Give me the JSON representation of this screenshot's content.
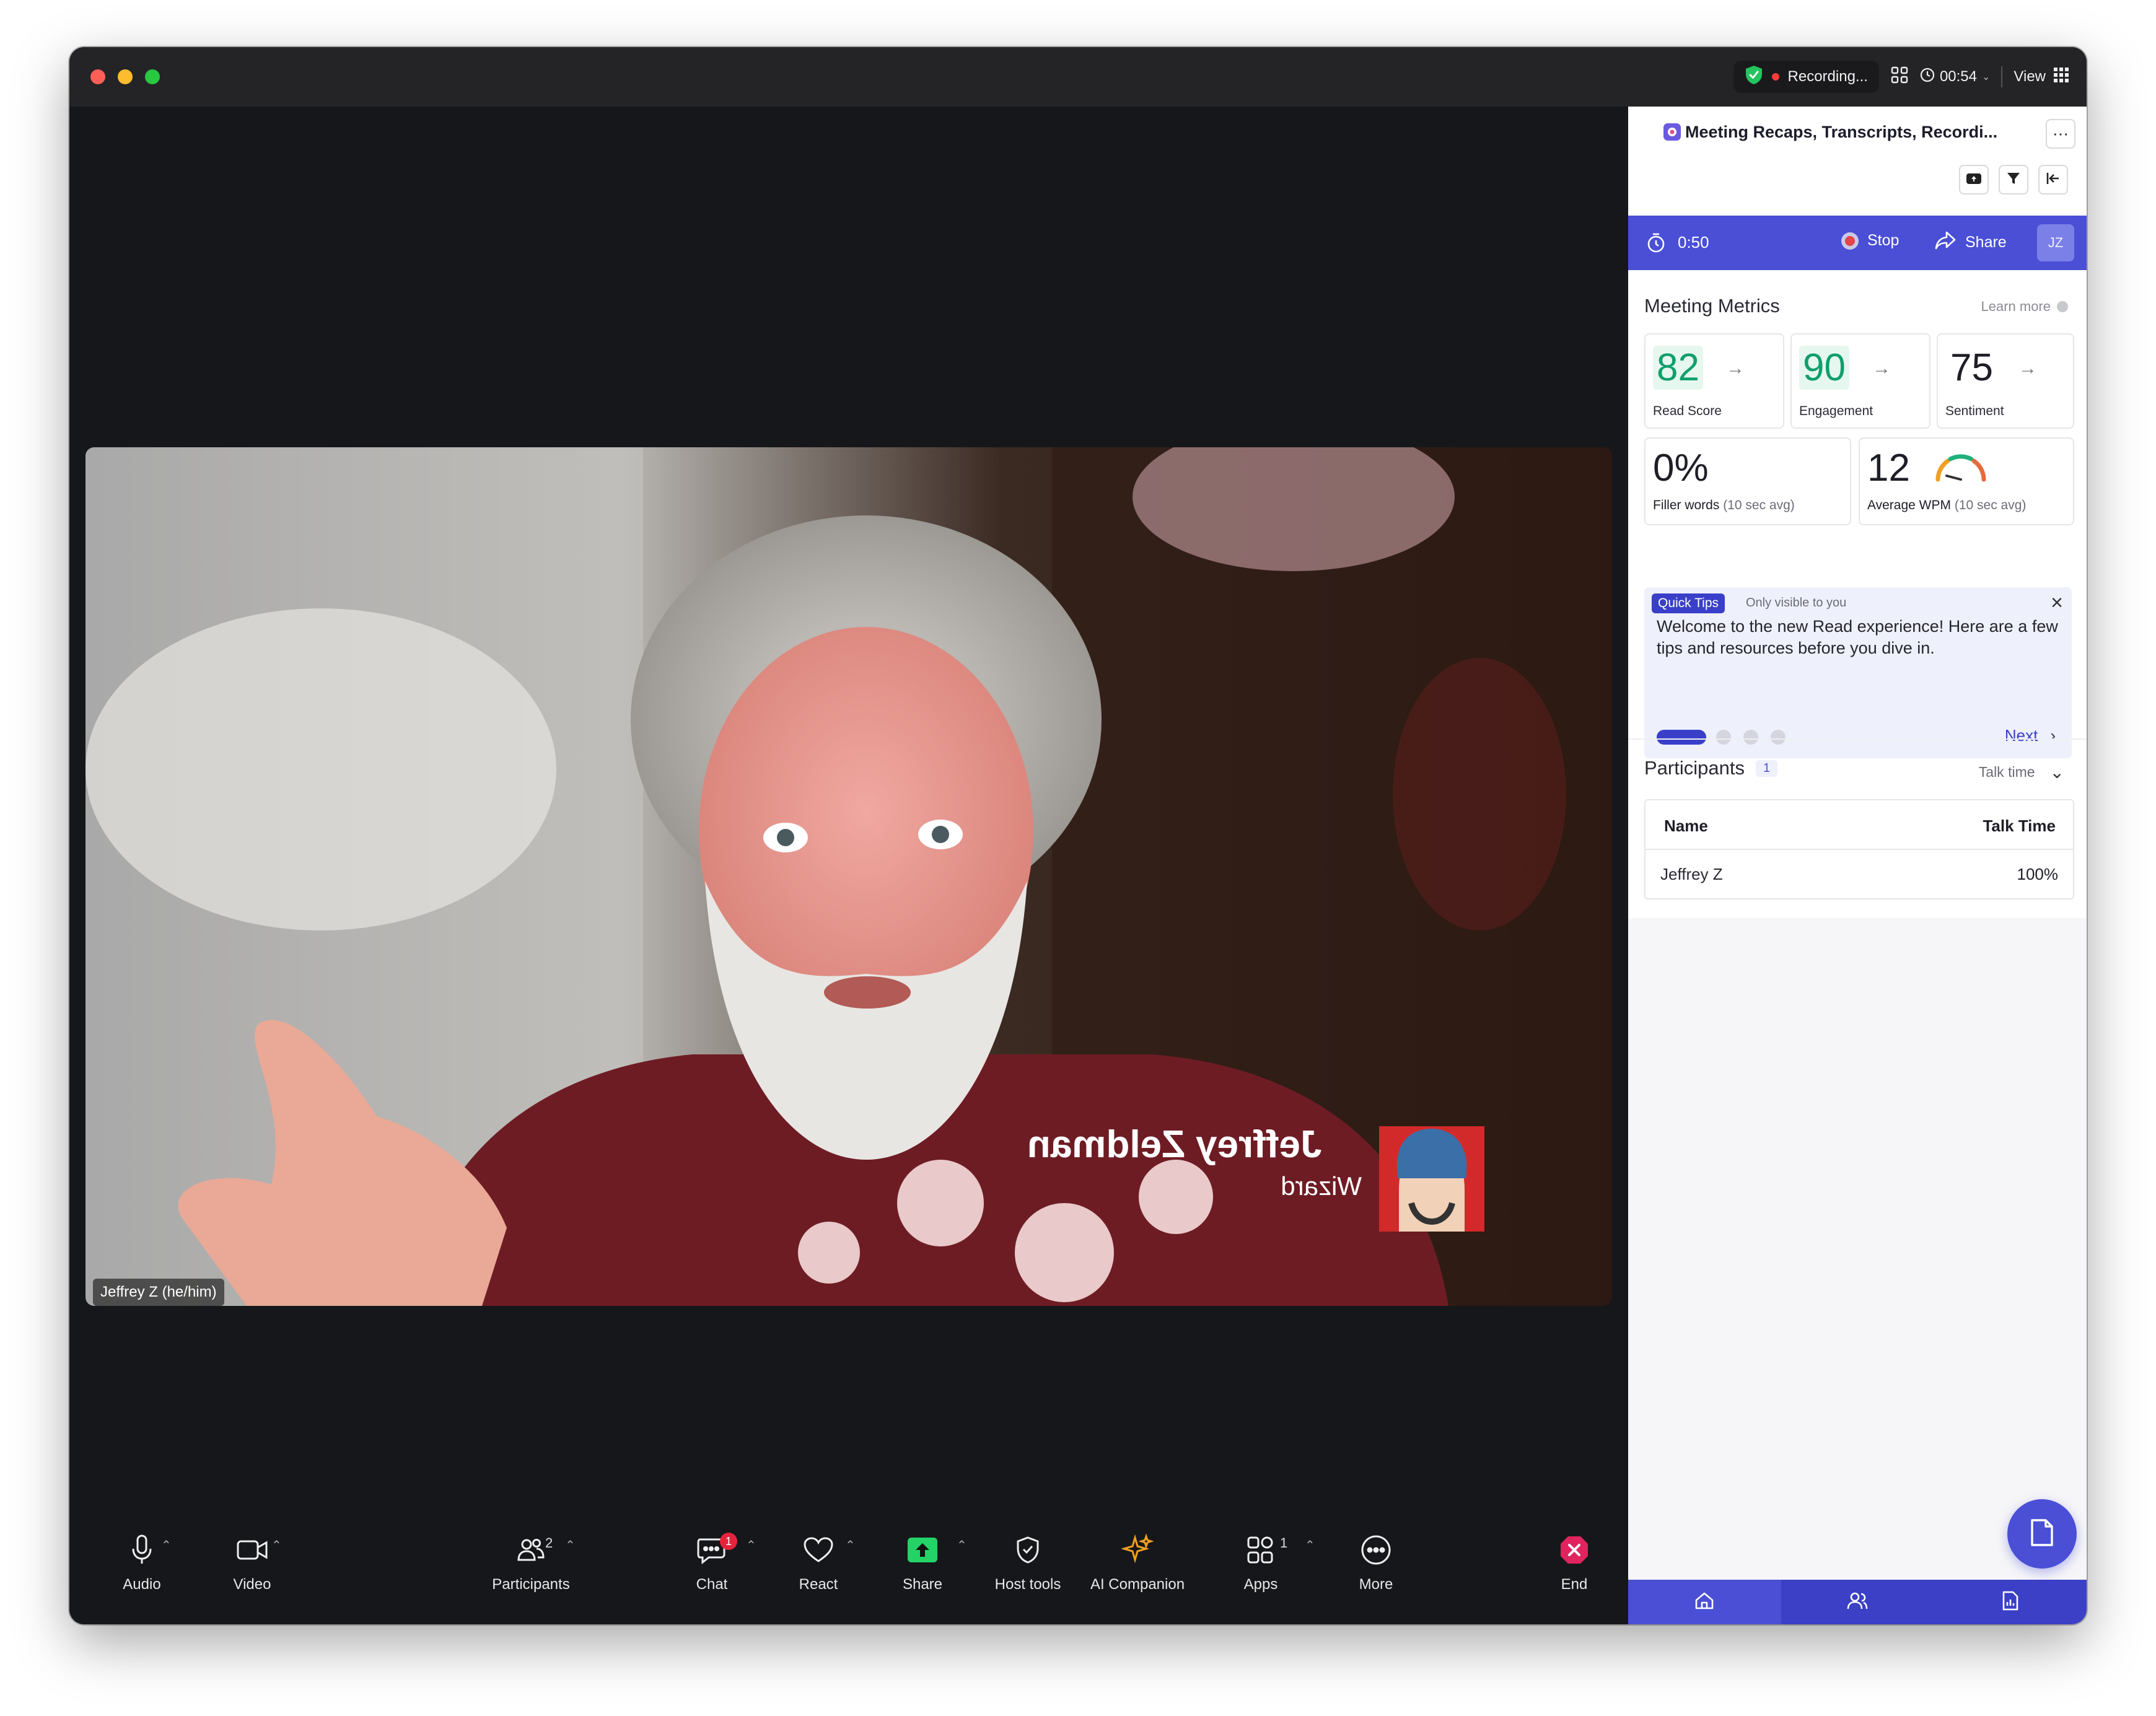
{
  "topbar": {
    "recording_label": "Recording...",
    "timer": "00:54",
    "view_label": "View"
  },
  "video": {
    "participant_label": "Jeffrey Z (he/him)",
    "overlay_name": "Jeffrey Zeldman",
    "overlay_role": "Wizard"
  },
  "toolbar": {
    "audio_label": "Audio",
    "video_label": "Video",
    "participants_label": "Participants",
    "participants_count": "2",
    "chat_label": "Chat",
    "chat_badge": "1",
    "react_label": "React",
    "share_label": "Share",
    "host_tools_label": "Host tools",
    "ai_companion_label": "AI Companion",
    "apps_label": "Apps",
    "apps_count": "1",
    "more_label": "More",
    "end_label": "End"
  },
  "panel": {
    "title": "Meeting Recaps, Transcripts, Recordi...",
    "timer": "0:50",
    "stop_label": "Stop",
    "share_label": "Share",
    "user_initials": "JZ",
    "metrics": {
      "title": "Meeting Metrics",
      "learn_more": "Learn more",
      "read_score": {
        "value": "82",
        "label": "Read Score"
      },
      "engagement": {
        "value": "90",
        "label": "Engagement"
      },
      "sentiment": {
        "value": "75",
        "label": "Sentiment"
      },
      "filler": {
        "value": "0%",
        "label_bold": "Filler words",
        "label_sub": "(10 sec avg)"
      },
      "wpm": {
        "value": "12",
        "label_bold": "Average WPM",
        "label_sub": "(10 sec avg)"
      }
    },
    "tips": {
      "badge": "Quick Tips",
      "visibility": "Only visible to you",
      "text": "Welcome to the new Read experience! Here are a few tips and resources before you dive in.",
      "next_label": "Next",
      "page": 1,
      "pages": 4
    },
    "participants": {
      "title": "Participants",
      "count": "1",
      "sort_label": "Talk time",
      "col_name": "Name",
      "col_talk": "Talk Time",
      "rows": [
        {
          "name": "Jeffrey Z",
          "talk": "100%"
        }
      ]
    }
  },
  "colors": {
    "accent": "#4a4fd6",
    "score_green": "#0f9f6e",
    "zoom_green": "#23d366",
    "end_red": "#e0245e",
    "ai_gold": "#f0a020"
  }
}
